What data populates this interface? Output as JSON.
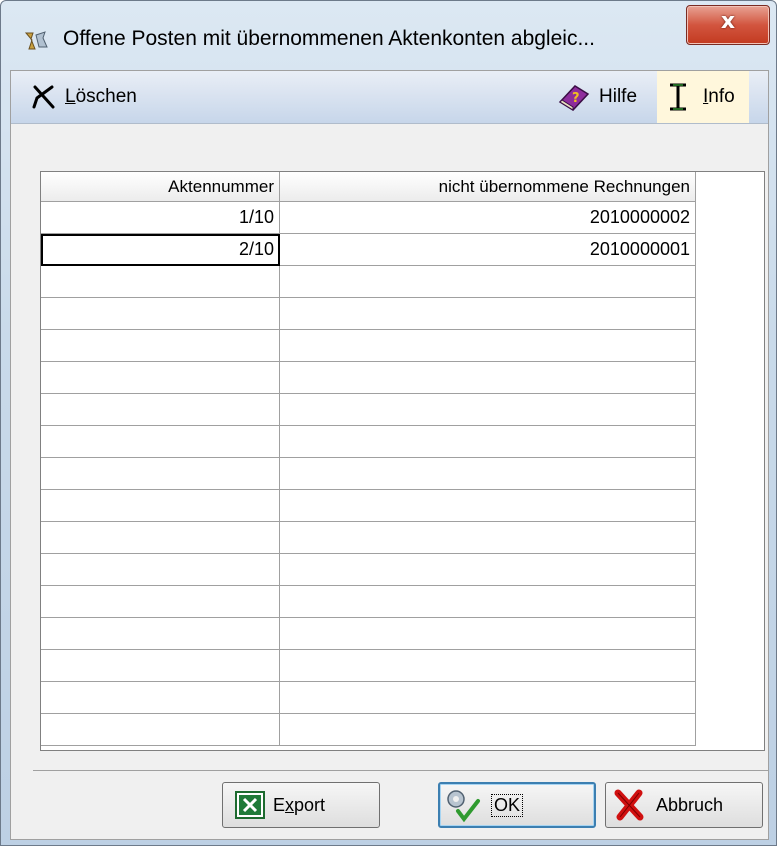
{
  "window": {
    "title": "Offene Posten mit übernommenen Aktenkonten abgleic...",
    "close_label": "x"
  },
  "toolbar": {
    "delete_label_u": "L",
    "delete_label_rest": "öschen",
    "help_label": "Hilfe",
    "info_label_u": "I",
    "info_label_rest": "nfo"
  },
  "table": {
    "columns": [
      "Aktennummer",
      "nicht übernommene Rechnungen"
    ],
    "rows": [
      [
        "1/10",
        "2010000002"
      ],
      [
        "2/10",
        "2010000001"
      ]
    ],
    "empty_rows": 15
  },
  "buttons": {
    "export_pre": "E",
    "export_u": "x",
    "export_post": "port",
    "ok_label": "OK",
    "cancel_label": "Abbruch"
  },
  "icons": [
    "app-icon",
    "delete-x-icon",
    "help-book-icon",
    "info-cursor-icon",
    "excel-icon",
    "ok-check-icon",
    "cancel-x-icon"
  ]
}
